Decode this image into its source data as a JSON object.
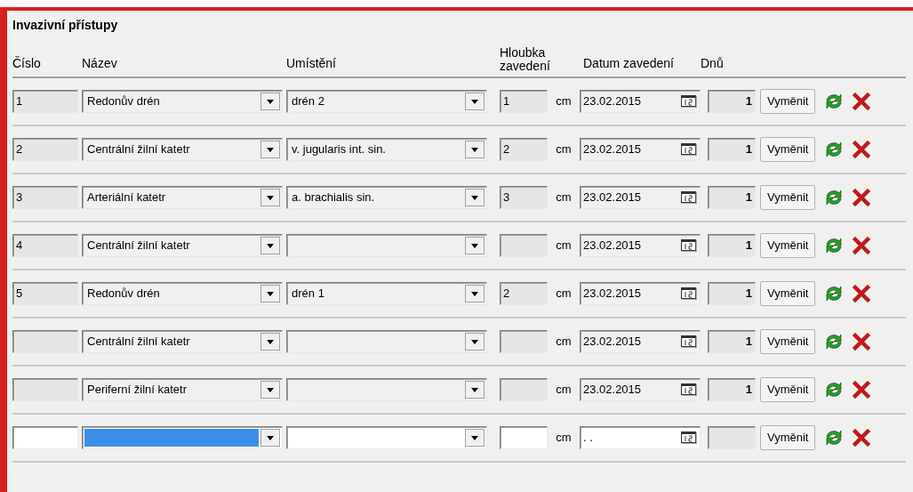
{
  "panel": {
    "title": "Invazivní přístupy"
  },
  "columns": [
    {
      "label": "Číslo"
    },
    {
      "label": "Název"
    },
    {
      "label": "Umístění"
    },
    {
      "label": "Hloubka zavedení"
    },
    {
      "label": "Datum zavedení"
    },
    {
      "label": "Dnů"
    }
  ],
  "rows": [
    {
      "editable": false,
      "number": "1",
      "name": "Redonův drén",
      "name_selected": false,
      "location": "drén 2",
      "depth": "1",
      "unit": "cm",
      "date": "23.02.2015",
      "days": "1",
      "button": "Vyměnit"
    },
    {
      "editable": false,
      "number": "2",
      "name": "Centrální žilní katetr",
      "name_selected": false,
      "location": "v. jugularis int. sin.",
      "depth": "2",
      "unit": "cm",
      "date": "23.02.2015",
      "days": "1",
      "button": "Vyměnit"
    },
    {
      "editable": false,
      "number": "3",
      "name": "Arteriální katetr",
      "name_selected": false,
      "location": "a. brachialis sin.",
      "depth": "3",
      "unit": "cm",
      "date": "23.02.2015",
      "days": "1",
      "button": "Vyměnit"
    },
    {
      "editable": false,
      "number": "4",
      "name": "Centrální žilní katetr",
      "name_selected": false,
      "unit": "cm",
      "date": "23.02.2015",
      "days": "1",
      "button": "Vyměnit"
    },
    {
      "editable": false,
      "number": "5",
      "name": "Redonův drén",
      "name_selected": false,
      "location": "drén 1",
      "depth": "2",
      "unit": "cm",
      "date": "23.02.2015",
      "days": "1",
      "button": "Vyměnit"
    },
    {
      "editable": false,
      "name": "Centrální žilní katetr",
      "name_selected": false,
      "unit": "cm",
      "date": "23.02.2015",
      "days": "1",
      "button": "Vyměnit"
    },
    {
      "editable": false,
      "name": "Periferní žilní katetr",
      "name_selected": false,
      "unit": "cm",
      "date": "23.02.2015",
      "days": "1",
      "button": "Vyměnit"
    },
    {
      "editable": true,
      "name_selected": true,
      "unit": "cm",
      "date": ". .",
      "button": "Vyměnit"
    }
  ]
}
